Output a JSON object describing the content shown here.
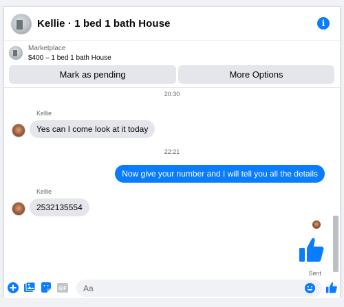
{
  "header": {
    "title": "Kellie · 1 bed 1 bath House",
    "info_icon": "info-icon",
    "accent_color": "#0a7cff"
  },
  "listing": {
    "label": "Marketplace",
    "price_title": "$400 – 1 bed 1 bath House"
  },
  "actions": {
    "pending_label": "Mark as pending",
    "more_label": "More Options"
  },
  "messages": {
    "timestamps": [
      "20:30",
      "22:21"
    ],
    "sender_name": "Kellie",
    "incoming": [
      "Yes can I come look at it today",
      "2532135554"
    ],
    "outgoing": [
      "Now give your number and I will tell you all the details"
    ],
    "sent_status": "Sent"
  },
  "composer": {
    "placeholder": "Aa",
    "icons": [
      "plus-icon",
      "photo-icon",
      "sticker-icon",
      "gif-icon",
      "emoji-icon",
      "like-icon"
    ],
    "gif_label": "GIF"
  },
  "colors": {
    "outgoing_bubble": "#0a7cff",
    "incoming_bubble": "#e4e6eb",
    "button_bg": "#e4e6eb"
  }
}
